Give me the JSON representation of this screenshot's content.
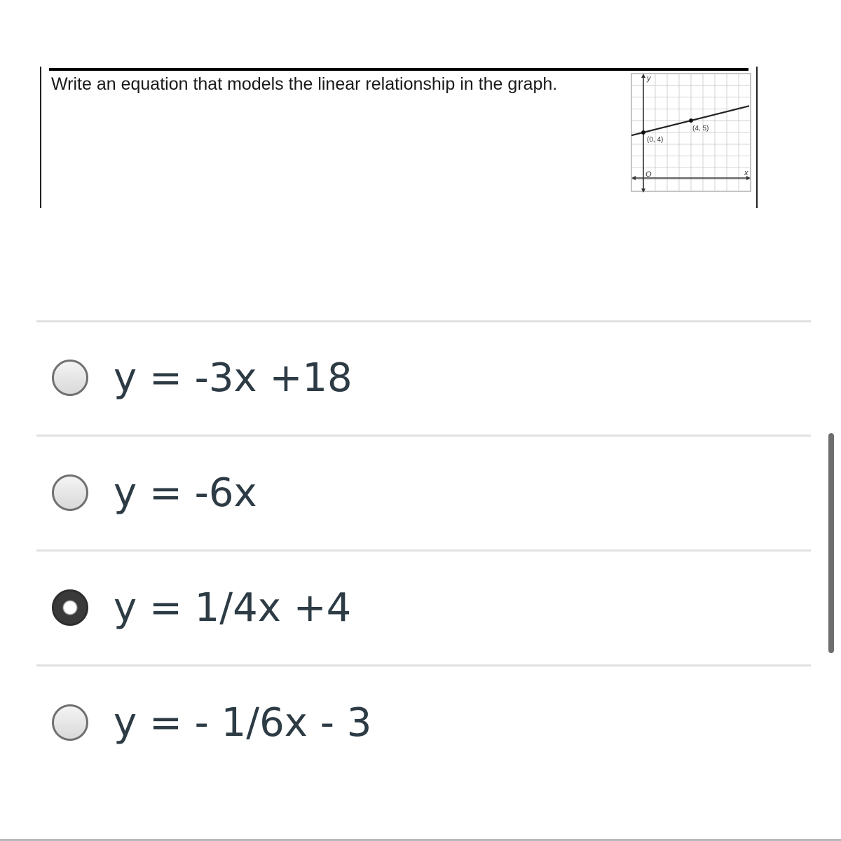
{
  "question": {
    "text": "Write an equation that models the linear relationship in the graph.",
    "graph": {
      "y_axis_label": "y",
      "x_axis_label": "x",
      "origin_label": "O",
      "point_a_label": "(0, 4)",
      "point_b_label": "(4, 5)",
      "points": [
        {
          "x": 0,
          "y": 4
        },
        {
          "x": 4,
          "y": 5
        }
      ]
    }
  },
  "options": [
    {
      "label": "y = -3x +18",
      "selected": false
    },
    {
      "label": "y = -6x",
      "selected": false
    },
    {
      "label": "y = 1/4x +4",
      "selected": true
    },
    {
      "label": "y = - 1/6x - 3",
      "selected": false
    }
  ],
  "colors": {
    "text": "#2d3b45",
    "divider": "#dfe1e3",
    "radio_border": "#707070",
    "radio_checked": "#3a3a3a"
  }
}
